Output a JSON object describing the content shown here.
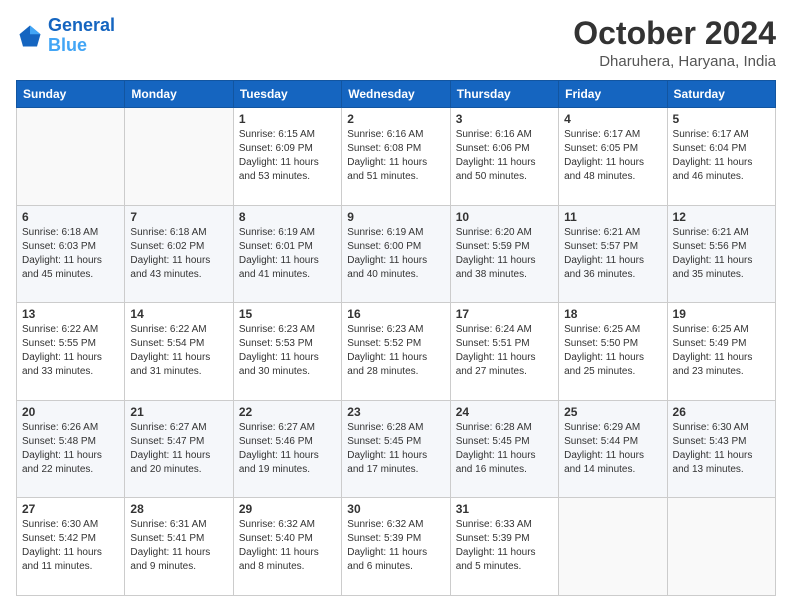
{
  "logo": {
    "line1": "General",
    "line2": "Blue"
  },
  "title": "October 2024",
  "location": "Dharuhera, Haryana, India",
  "days_of_week": [
    "Sunday",
    "Monday",
    "Tuesday",
    "Wednesday",
    "Thursday",
    "Friday",
    "Saturday"
  ],
  "weeks": [
    [
      {
        "day": "",
        "sunrise": "",
        "sunset": "",
        "daylight": ""
      },
      {
        "day": "",
        "sunrise": "",
        "sunset": "",
        "daylight": ""
      },
      {
        "day": "1",
        "sunrise": "Sunrise: 6:15 AM",
        "sunset": "Sunset: 6:09 PM",
        "daylight": "Daylight: 11 hours and 53 minutes."
      },
      {
        "day": "2",
        "sunrise": "Sunrise: 6:16 AM",
        "sunset": "Sunset: 6:08 PM",
        "daylight": "Daylight: 11 hours and 51 minutes."
      },
      {
        "day": "3",
        "sunrise": "Sunrise: 6:16 AM",
        "sunset": "Sunset: 6:06 PM",
        "daylight": "Daylight: 11 hours and 50 minutes."
      },
      {
        "day": "4",
        "sunrise": "Sunrise: 6:17 AM",
        "sunset": "Sunset: 6:05 PM",
        "daylight": "Daylight: 11 hours and 48 minutes."
      },
      {
        "day": "5",
        "sunrise": "Sunrise: 6:17 AM",
        "sunset": "Sunset: 6:04 PM",
        "daylight": "Daylight: 11 hours and 46 minutes."
      }
    ],
    [
      {
        "day": "6",
        "sunrise": "Sunrise: 6:18 AM",
        "sunset": "Sunset: 6:03 PM",
        "daylight": "Daylight: 11 hours and 45 minutes."
      },
      {
        "day": "7",
        "sunrise": "Sunrise: 6:18 AM",
        "sunset": "Sunset: 6:02 PM",
        "daylight": "Daylight: 11 hours and 43 minutes."
      },
      {
        "day": "8",
        "sunrise": "Sunrise: 6:19 AM",
        "sunset": "Sunset: 6:01 PM",
        "daylight": "Daylight: 11 hours and 41 minutes."
      },
      {
        "day": "9",
        "sunrise": "Sunrise: 6:19 AM",
        "sunset": "Sunset: 6:00 PM",
        "daylight": "Daylight: 11 hours and 40 minutes."
      },
      {
        "day": "10",
        "sunrise": "Sunrise: 6:20 AM",
        "sunset": "Sunset: 5:59 PM",
        "daylight": "Daylight: 11 hours and 38 minutes."
      },
      {
        "day": "11",
        "sunrise": "Sunrise: 6:21 AM",
        "sunset": "Sunset: 5:57 PM",
        "daylight": "Daylight: 11 hours and 36 minutes."
      },
      {
        "day": "12",
        "sunrise": "Sunrise: 6:21 AM",
        "sunset": "Sunset: 5:56 PM",
        "daylight": "Daylight: 11 hours and 35 minutes."
      }
    ],
    [
      {
        "day": "13",
        "sunrise": "Sunrise: 6:22 AM",
        "sunset": "Sunset: 5:55 PM",
        "daylight": "Daylight: 11 hours and 33 minutes."
      },
      {
        "day": "14",
        "sunrise": "Sunrise: 6:22 AM",
        "sunset": "Sunset: 5:54 PM",
        "daylight": "Daylight: 11 hours and 31 minutes."
      },
      {
        "day": "15",
        "sunrise": "Sunrise: 6:23 AM",
        "sunset": "Sunset: 5:53 PM",
        "daylight": "Daylight: 11 hours and 30 minutes."
      },
      {
        "day": "16",
        "sunrise": "Sunrise: 6:23 AM",
        "sunset": "Sunset: 5:52 PM",
        "daylight": "Daylight: 11 hours and 28 minutes."
      },
      {
        "day": "17",
        "sunrise": "Sunrise: 6:24 AM",
        "sunset": "Sunset: 5:51 PM",
        "daylight": "Daylight: 11 hours and 27 minutes."
      },
      {
        "day": "18",
        "sunrise": "Sunrise: 6:25 AM",
        "sunset": "Sunset: 5:50 PM",
        "daylight": "Daylight: 11 hours and 25 minutes."
      },
      {
        "day": "19",
        "sunrise": "Sunrise: 6:25 AM",
        "sunset": "Sunset: 5:49 PM",
        "daylight": "Daylight: 11 hours and 23 minutes."
      }
    ],
    [
      {
        "day": "20",
        "sunrise": "Sunrise: 6:26 AM",
        "sunset": "Sunset: 5:48 PM",
        "daylight": "Daylight: 11 hours and 22 minutes."
      },
      {
        "day": "21",
        "sunrise": "Sunrise: 6:27 AM",
        "sunset": "Sunset: 5:47 PM",
        "daylight": "Daylight: 11 hours and 20 minutes."
      },
      {
        "day": "22",
        "sunrise": "Sunrise: 6:27 AM",
        "sunset": "Sunset: 5:46 PM",
        "daylight": "Daylight: 11 hours and 19 minutes."
      },
      {
        "day": "23",
        "sunrise": "Sunrise: 6:28 AM",
        "sunset": "Sunset: 5:45 PM",
        "daylight": "Daylight: 11 hours and 17 minutes."
      },
      {
        "day": "24",
        "sunrise": "Sunrise: 6:28 AM",
        "sunset": "Sunset: 5:45 PM",
        "daylight": "Daylight: 11 hours and 16 minutes."
      },
      {
        "day": "25",
        "sunrise": "Sunrise: 6:29 AM",
        "sunset": "Sunset: 5:44 PM",
        "daylight": "Daylight: 11 hours and 14 minutes."
      },
      {
        "day": "26",
        "sunrise": "Sunrise: 6:30 AM",
        "sunset": "Sunset: 5:43 PM",
        "daylight": "Daylight: 11 hours and 13 minutes."
      }
    ],
    [
      {
        "day": "27",
        "sunrise": "Sunrise: 6:30 AM",
        "sunset": "Sunset: 5:42 PM",
        "daylight": "Daylight: 11 hours and 11 minutes."
      },
      {
        "day": "28",
        "sunrise": "Sunrise: 6:31 AM",
        "sunset": "Sunset: 5:41 PM",
        "daylight": "Daylight: 11 hours and 9 minutes."
      },
      {
        "day": "29",
        "sunrise": "Sunrise: 6:32 AM",
        "sunset": "Sunset: 5:40 PM",
        "daylight": "Daylight: 11 hours and 8 minutes."
      },
      {
        "day": "30",
        "sunrise": "Sunrise: 6:32 AM",
        "sunset": "Sunset: 5:39 PM",
        "daylight": "Daylight: 11 hours and 6 minutes."
      },
      {
        "day": "31",
        "sunrise": "Sunrise: 6:33 AM",
        "sunset": "Sunset: 5:39 PM",
        "daylight": "Daylight: 11 hours and 5 minutes."
      },
      {
        "day": "",
        "sunrise": "",
        "sunset": "",
        "daylight": ""
      },
      {
        "day": "",
        "sunrise": "",
        "sunset": "",
        "daylight": ""
      }
    ]
  ]
}
